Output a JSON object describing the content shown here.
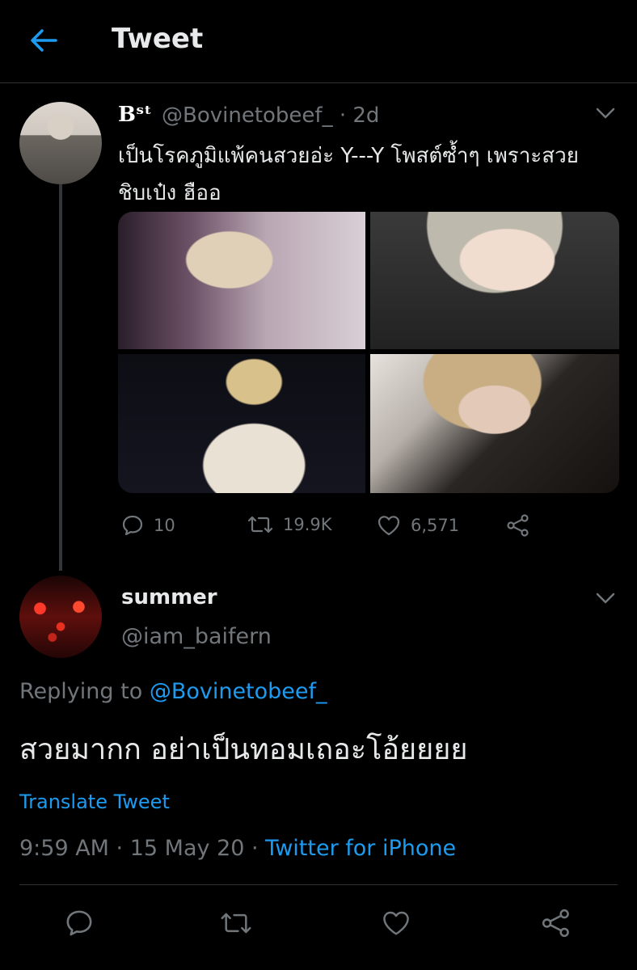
{
  "header": {
    "title": "Tweet"
  },
  "parent_tweet": {
    "author_name": "Bˢᵗ",
    "handle_time": "@Bovinetobeef_ · 2d",
    "text": "เป็นโรคภูมิแพ้คนสวยอ่ะ Y---Y โพสต์ซ้ำๆ เพราะสวยชิบเป๋ง ฮืออ",
    "replies": "10",
    "retweets": "19.9K",
    "likes": "6,571"
  },
  "reply_tweet": {
    "author_name": "summer",
    "handle": "@iam_baifern",
    "replying_prefix": "Replying to ",
    "replying_to": "@Bovinetobeef_",
    "text": "สวยมากก อย่าเป็นทอมเถอะโอ้ยยยย",
    "translate_label": "Translate Tweet",
    "timestamp": "9:59 AM · 15 May 20 · ",
    "source": "Twitter for iPhone"
  },
  "colors": {
    "accent": "#1d9bf0",
    "muted": "#71767b",
    "background": "#000000"
  }
}
